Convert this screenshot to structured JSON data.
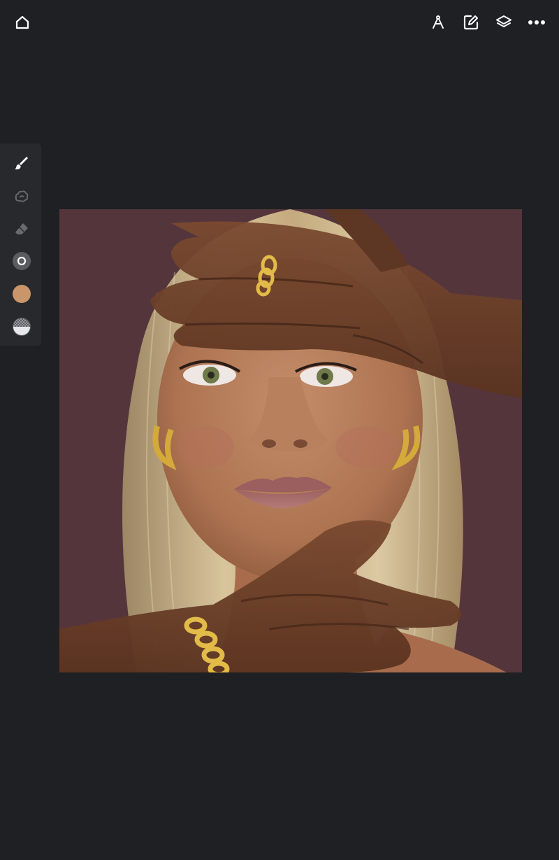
{
  "topbar": {
    "left": {
      "icon": "home-icon"
    },
    "right": [
      "ruler-compass-icon",
      "edit-note-icon",
      "layers-icon",
      "more-options-icon"
    ]
  },
  "toolbar": {
    "tools": [
      "brush-icon",
      "smudge-icon",
      "eraser-icon",
      "brush-size-icon",
      "color-swatch-icon",
      "opacity-icon"
    ],
    "current_color": "#c8966a"
  },
  "canvas": {
    "background_color": "#55353c",
    "subject": "digital-portrait-illustration"
  }
}
